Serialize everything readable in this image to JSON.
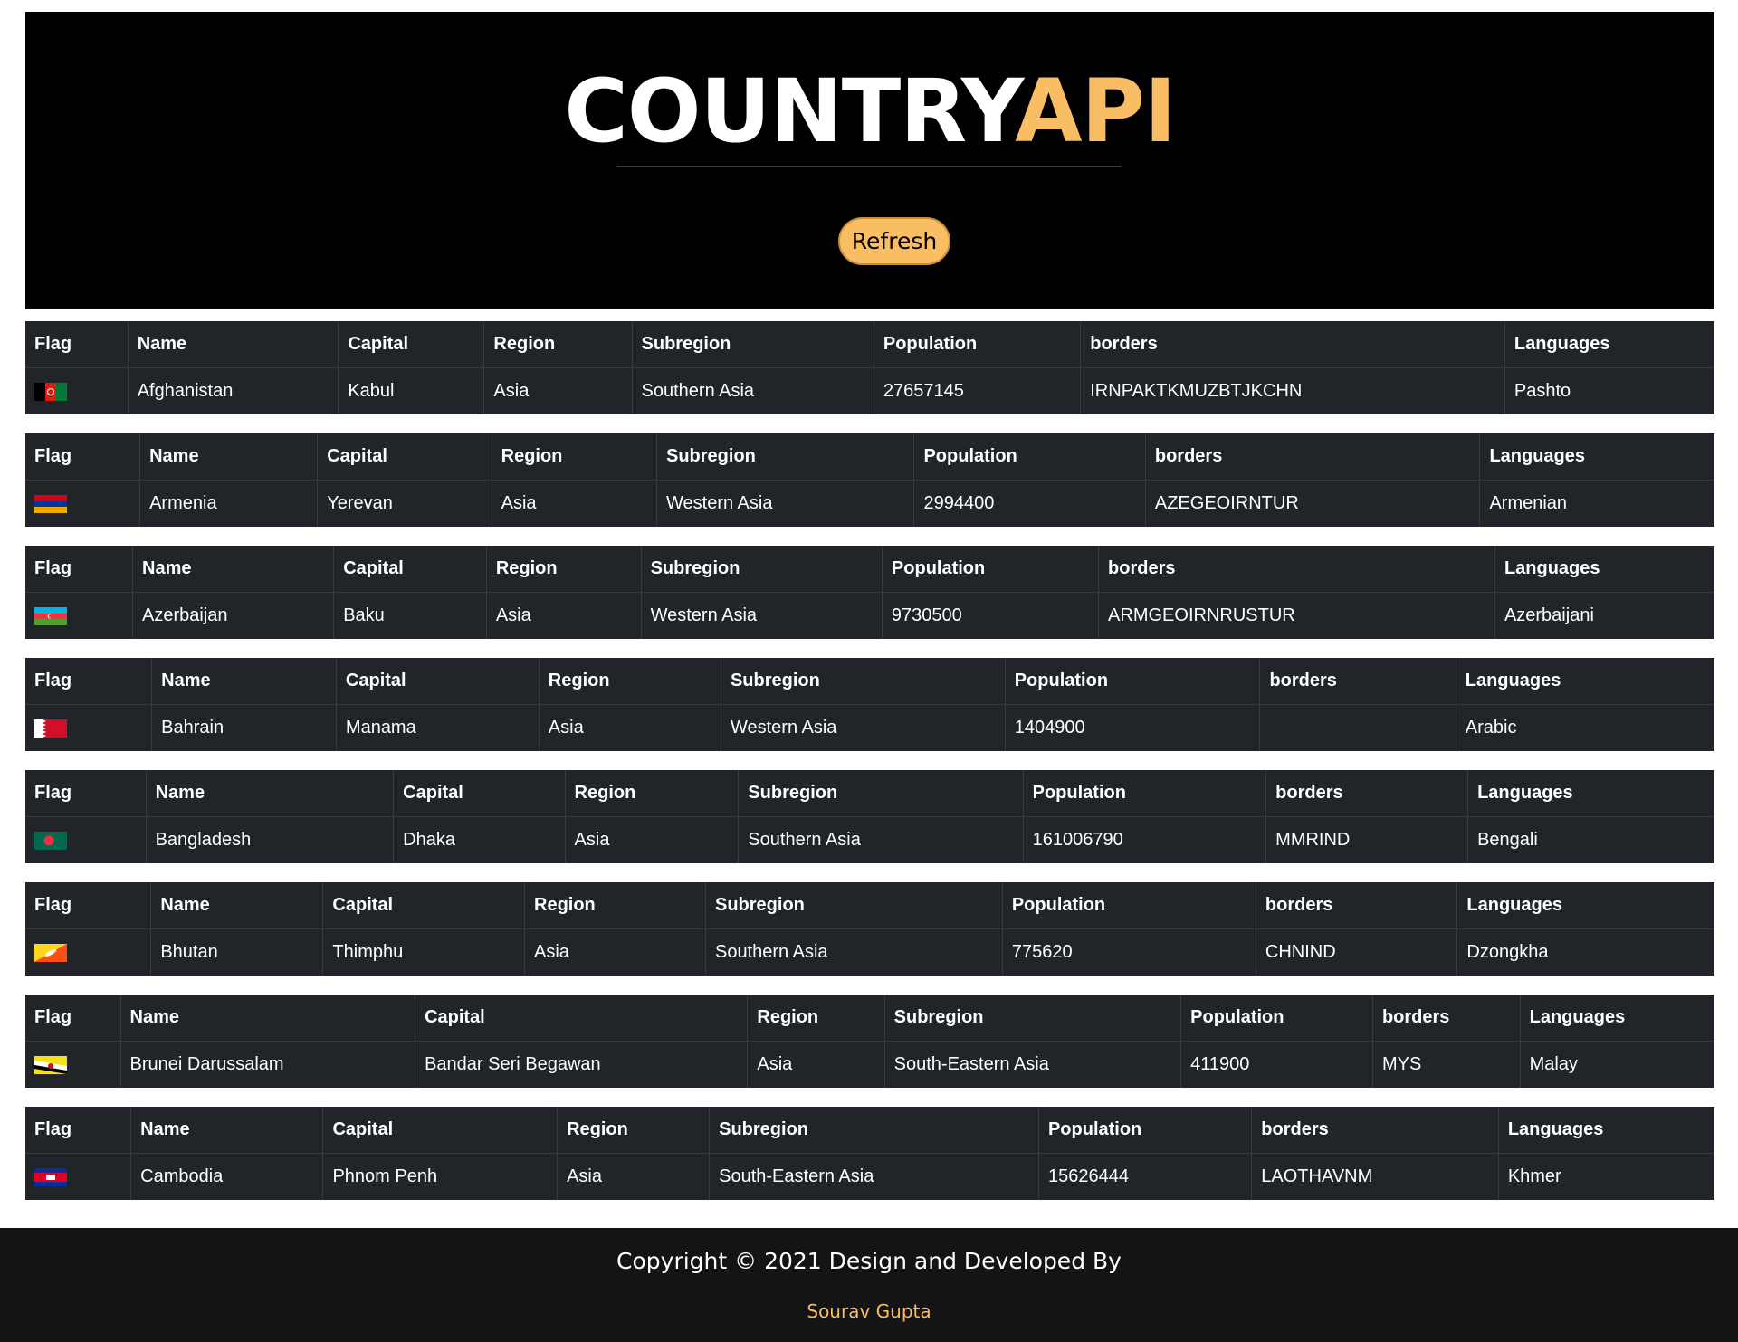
{
  "hero": {
    "title_main": "COUNTRY",
    "title_accent": "API",
    "refresh_label": "Refresh",
    "accent_color": "#f9bd63"
  },
  "columns": [
    "Flag",
    "Name",
    "Capital",
    "Region",
    "Subregion",
    "Population",
    "borders",
    "Languages"
  ],
  "countries": [
    {
      "flag": "afghanistan-flag",
      "name": "Afghanistan",
      "capital": "Kabul",
      "region": "Asia",
      "subregion": "Southern Asia",
      "population": "27657145",
      "borders": "IRNPAKTKMUZBTJKCHN",
      "languages": "Pashto"
    },
    {
      "flag": "armenia-flag",
      "name": "Armenia",
      "capital": "Yerevan",
      "region": "Asia",
      "subregion": "Western Asia",
      "population": "2994400",
      "borders": "AZEGEOIRNTUR",
      "languages": "Armenian"
    },
    {
      "flag": "azerbaijan-flag",
      "name": "Azerbaijan",
      "capital": "Baku",
      "region": "Asia",
      "subregion": "Western Asia",
      "population": "9730500",
      "borders": "ARMGEOIRNRUSTUR",
      "languages": "Azerbaijani"
    },
    {
      "flag": "bahrain-flag",
      "name": "Bahrain",
      "capital": "Manama",
      "region": "Asia",
      "subregion": "Western Asia",
      "population": "1404900",
      "borders": "",
      "languages": "Arabic"
    },
    {
      "flag": "bangladesh-flag",
      "name": "Bangladesh",
      "capital": "Dhaka",
      "region": "Asia",
      "subregion": "Southern Asia",
      "population": "161006790",
      "borders": "MMRIND",
      "languages": "Bengali"
    },
    {
      "flag": "bhutan-flag",
      "name": "Bhutan",
      "capital": "Thimphu",
      "region": "Asia",
      "subregion": "Southern Asia",
      "population": "775620",
      "borders": "CHNIND",
      "languages": "Dzongkha"
    },
    {
      "flag": "brunei-flag",
      "name": "Brunei Darussalam",
      "capital": "Bandar Seri Begawan",
      "region": "Asia",
      "subregion": "South-Eastern Asia",
      "population": "411900",
      "borders": "MYS",
      "languages": "Malay"
    },
    {
      "flag": "cambodia-flag",
      "name": "Cambodia",
      "capital": "Phnom Penh",
      "region": "Asia",
      "subregion": "South-Eastern Asia",
      "population": "15626444",
      "borders": "LAOTHAVNM",
      "languages": "Khmer"
    }
  ],
  "footer": {
    "copyright": "Copyright © 2021 Design and Developed By",
    "author": "Sourav Gupta"
  }
}
